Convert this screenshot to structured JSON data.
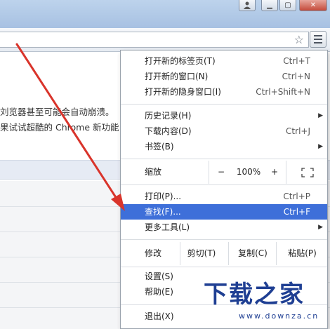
{
  "window": {
    "user_icon": "person-icon",
    "min_label": "▁",
    "max_label": "▢",
    "close_label": "✕"
  },
  "toolbar": {
    "star_icon": "star-icon",
    "star_glyph": "☆",
    "menu_icon": "hamburger-menu-icon"
  },
  "page": {
    "line1": "刘览器甚至可能会自动崩溃。",
    "line2": "果试试超酷的 Chrome 新功能"
  },
  "menu": {
    "items_top": [
      {
        "label": "打开新的标签页(T)",
        "shortcut": "Ctrl+T"
      },
      {
        "label": "打开新的窗口(N)",
        "shortcut": "Ctrl+N"
      },
      {
        "label": "打开新的隐身窗口(I)",
        "shortcut": "Ctrl+Shift+N"
      }
    ],
    "items_history": [
      {
        "label": "历史记录(H)",
        "shortcut": "",
        "submenu": "▶"
      },
      {
        "label": "下载内容(D)",
        "shortcut": "Ctrl+J",
        "submenu": ""
      },
      {
        "label": "书签(B)",
        "shortcut": "",
        "submenu": "▶"
      }
    ],
    "zoom": {
      "label": "缩放",
      "minus": "−",
      "value": "100%",
      "plus": "+",
      "fullscreen_icon": "fullscreen-icon"
    },
    "items_mid": [
      {
        "label": "打印(P)...",
        "shortcut": "Ctrl+P",
        "submenu": ""
      },
      {
        "label": "查找(F)...",
        "shortcut": "Ctrl+F",
        "submenu": ""
      },
      {
        "label": "更多工具(L)",
        "shortcut": "",
        "submenu": "▶"
      }
    ],
    "edit": {
      "label": "修改",
      "cut": "剪切(T)",
      "copy": "复制(C)",
      "paste": "粘贴(P)"
    },
    "items_bottom": [
      {
        "label": "设置(S)"
      },
      {
        "label": "帮助(E)"
      }
    ],
    "exit": {
      "label": "退出(X)"
    }
  },
  "colors": {
    "highlight": "#3e6fd9",
    "arrow": "#d9342b",
    "watermark": "#1f3f93"
  },
  "watermark": {
    "title": "下载之家",
    "url": "www.downza.cn"
  }
}
